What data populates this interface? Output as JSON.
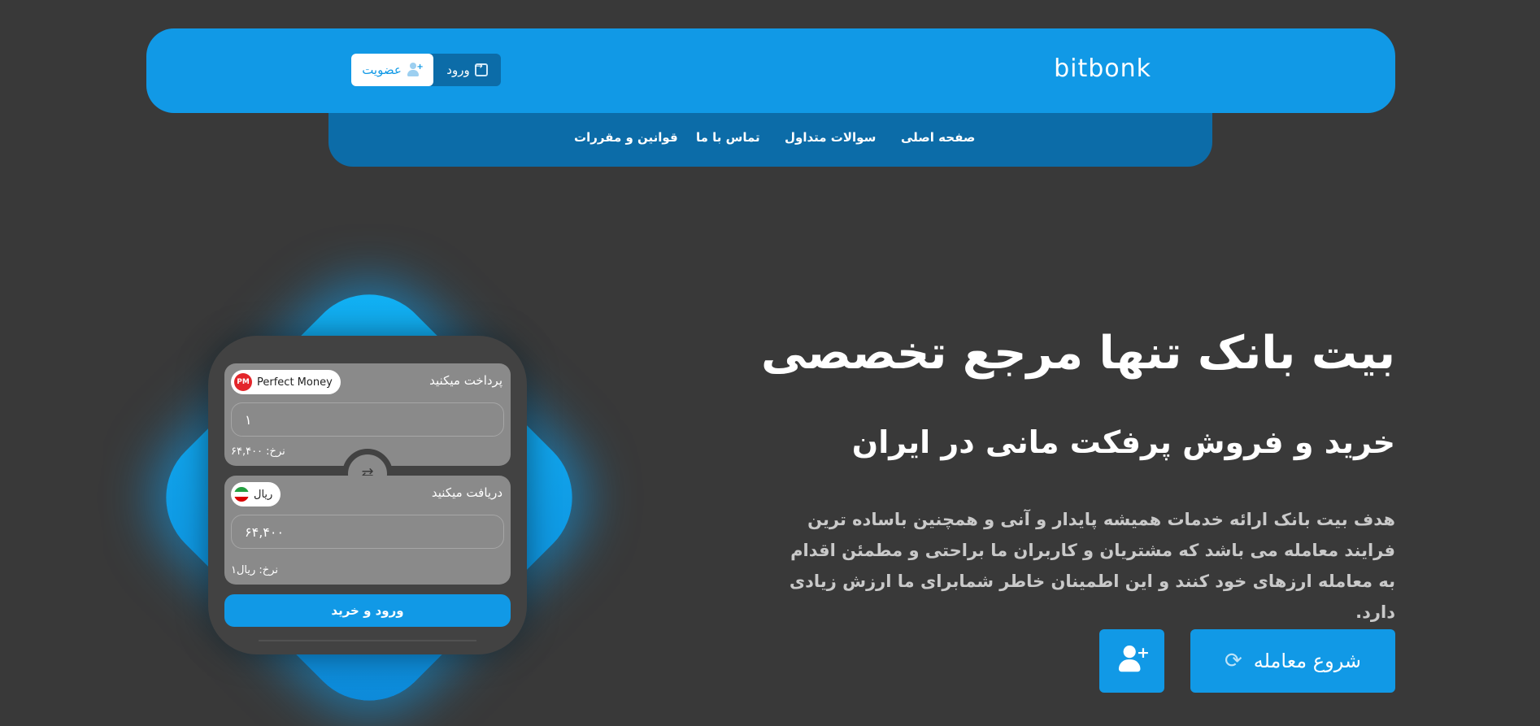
{
  "header": {
    "logo": "bitbonk",
    "login_label": "ورود",
    "signup_label": "عضویت"
  },
  "nav": {
    "items": [
      {
        "label": "صفحه اصلی"
      },
      {
        "label": "سوالات متداول"
      },
      {
        "label": "تماس با ما"
      },
      {
        "label": "قوانین و مقررات"
      }
    ]
  },
  "hero": {
    "title": "بیت بانک تنها مرجع تخصصی",
    "subtitle": "خرید و فروش پرفکت مانی در ایران",
    "description": "هدف بیت بانک ارائه خدمات همیشه پایدار و آنی و همچنین باساده ترین فرایند معامله می باشد که مشتریان و کاربران ما براحتی و مطمئن اقدام به معامله ارزهای خود کنند و این اطمینان خاطر شمابرای ما ارزش زیادی دارد.",
    "start_button": "شروع معامله"
  },
  "widget": {
    "pay": {
      "label": "پرداخت میکنید",
      "currency": "Perfect Money",
      "currency_icon_text": "PM",
      "amount": "۱",
      "rate": "نرخ: ۶۴,۴۰۰"
    },
    "receive": {
      "label": "دریافت میکنید",
      "currency": "ریال",
      "amount": "۶۴,۴۰۰",
      "rate": "نرخ: ریال۱"
    },
    "buy_button": "ورود و خرید"
  },
  "colors": {
    "background": "#393939",
    "accent": "#1199e6",
    "accent_dark": "#0c6ca8",
    "card": "#8a8a8a"
  }
}
